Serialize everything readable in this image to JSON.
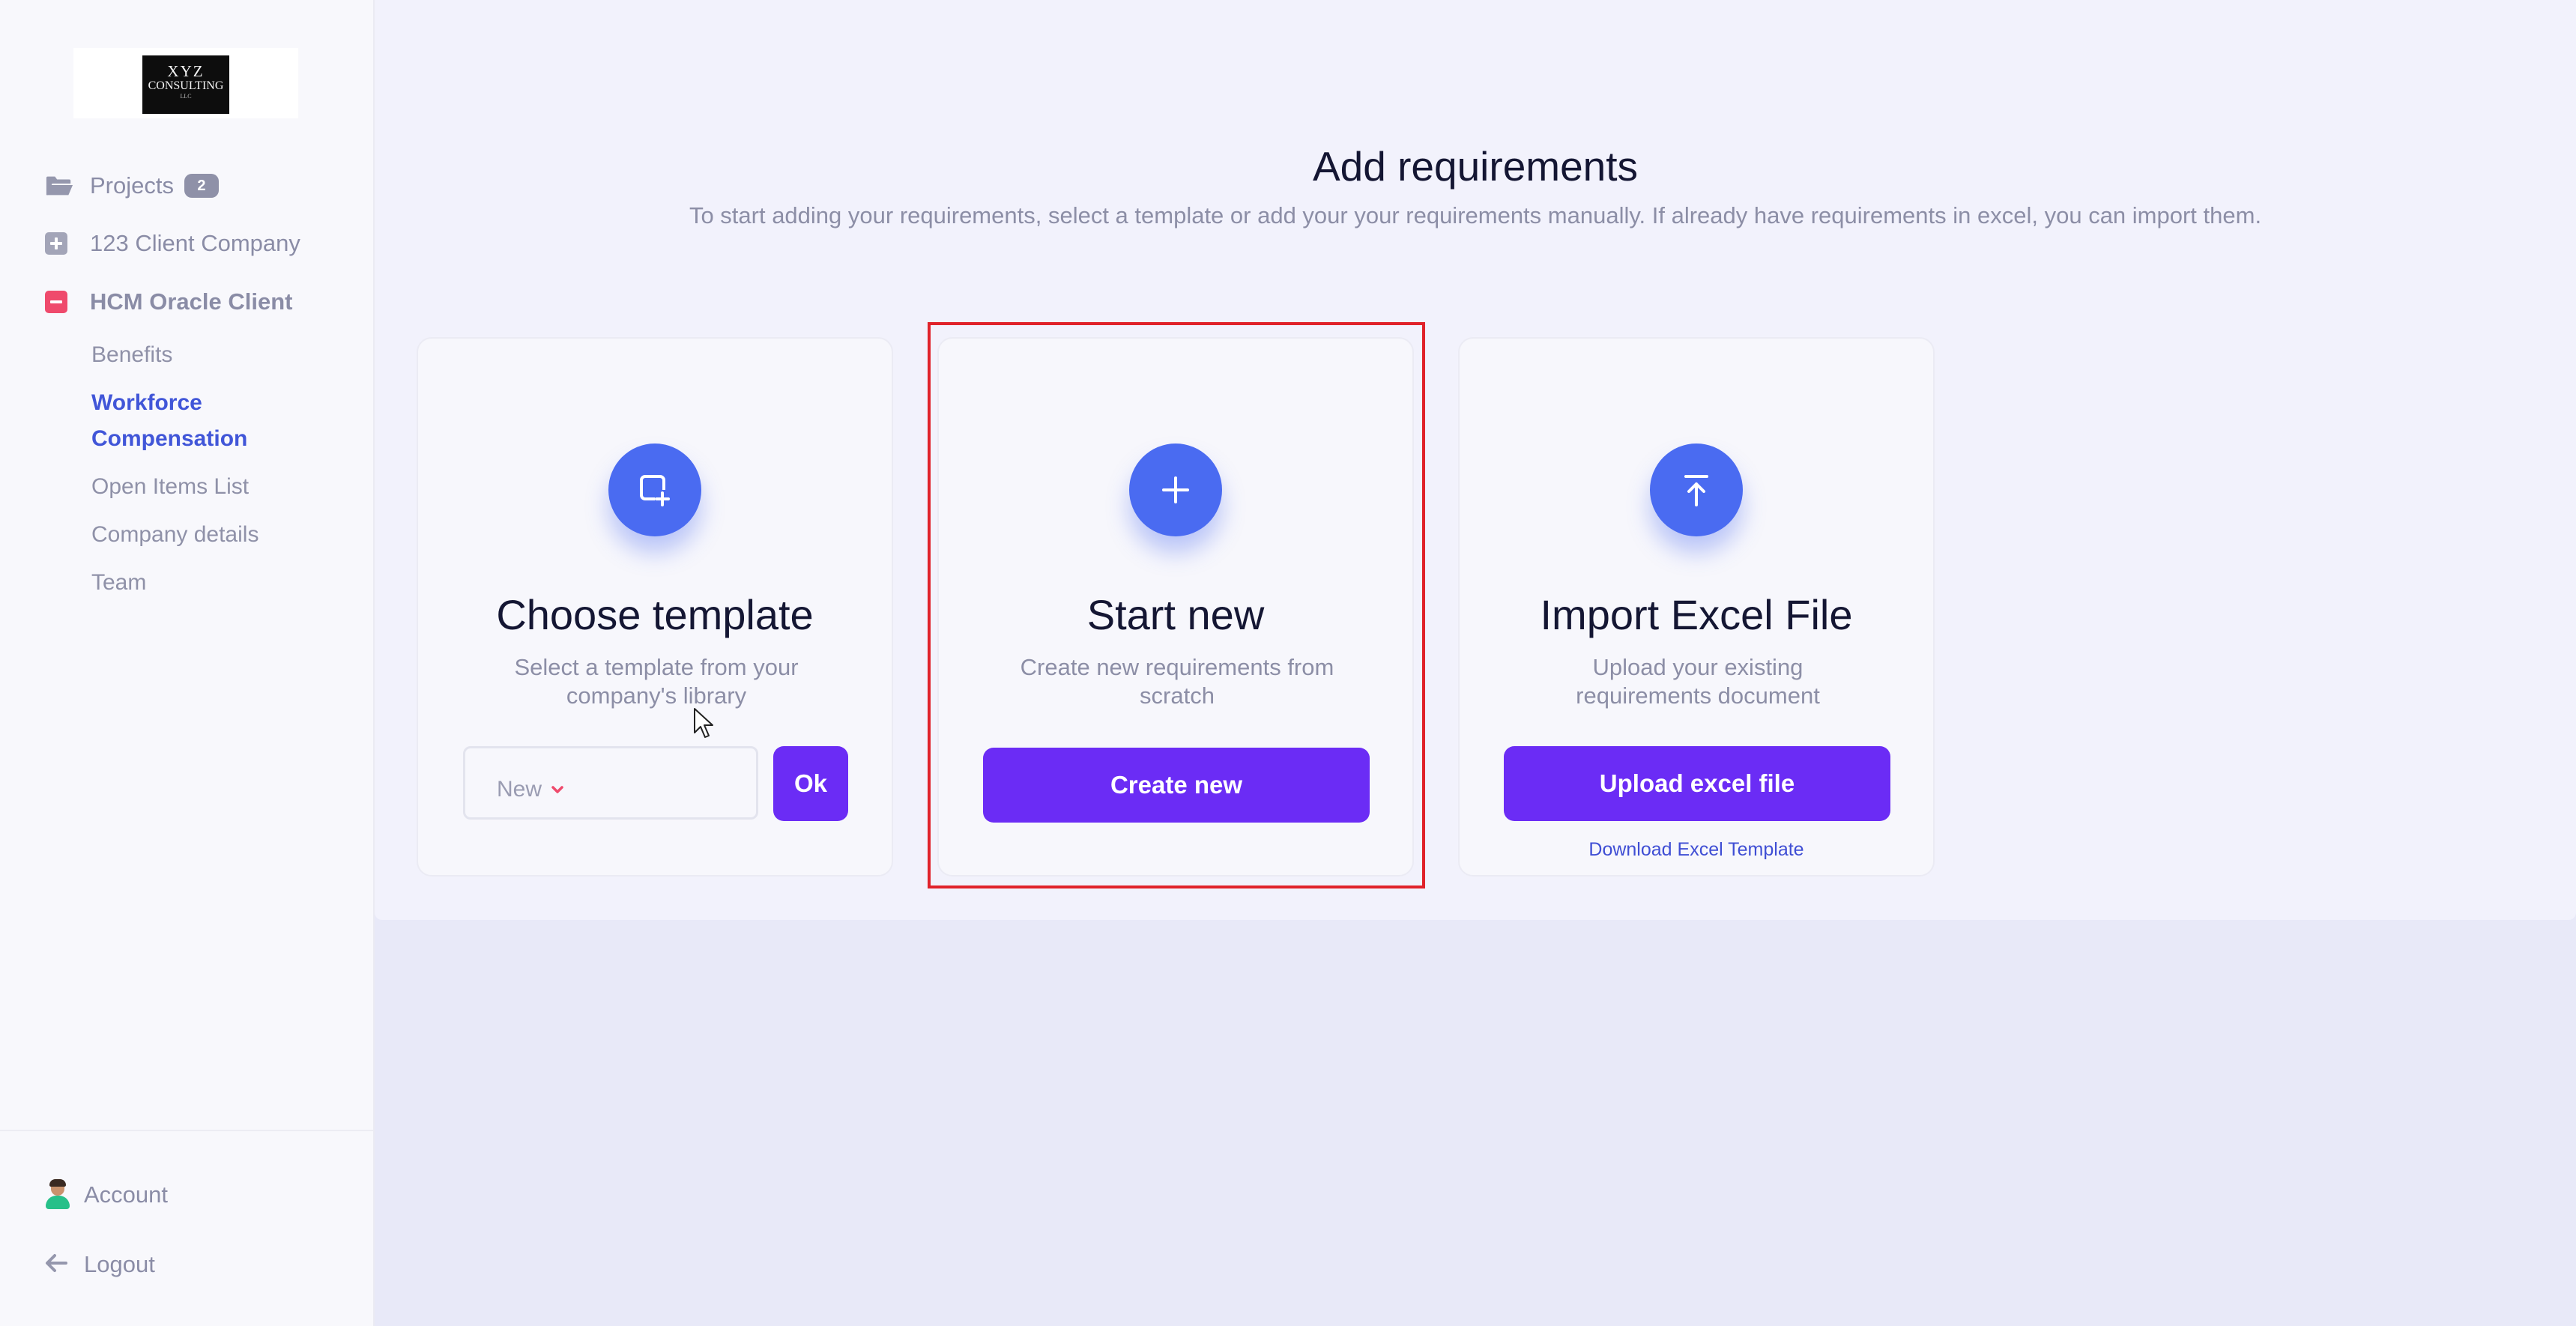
{
  "brand": {
    "logo_text_line1": "XYZ",
    "logo_text_line2": "CONSULTING",
    "logo_text_line3": "LLC"
  },
  "sidebar": {
    "projects": {
      "label": "Projects",
      "count": "2",
      "icon": "folder-open-icon"
    },
    "clients": [
      {
        "label": "123 Client Company",
        "expanded": false,
        "icon": "expand-plus-icon"
      },
      {
        "label": "HCM Oracle Client",
        "expanded": true,
        "icon": "collapse-minus-icon"
      }
    ],
    "sub_items": [
      {
        "label": "Benefits",
        "active": false
      },
      {
        "label": "Workforce Compensation",
        "label_line1": "Workforce",
        "label_line2": "Compensation",
        "active": true
      },
      {
        "label": "Open Items List",
        "active": false
      },
      {
        "label": "Company details",
        "active": false
      },
      {
        "label": "Team",
        "active": false
      }
    ],
    "account_label": "Account",
    "logout_label": "Logout"
  },
  "main": {
    "title": "Add requirements",
    "subtitle": "To start adding your requirements, select a template or add your your requirements manually. If already have requirements in excel, you can import them.",
    "cards": [
      {
        "icon": "add-template-icon",
        "title": "Choose template",
        "description": "Select a template from your company's library",
        "select_value": "New",
        "button_label": "Ok"
      },
      {
        "icon": "plus-icon",
        "title": "Start new",
        "description": "Create new requirements from scratch",
        "button_label": "Create new",
        "highlighted": true
      },
      {
        "icon": "upload-icon",
        "title": "Import Excel File",
        "description": "Upload your existing requirements document",
        "button_label": "Upload excel file",
        "link_label": "Download Excel Template"
      }
    ]
  },
  "colors": {
    "accent_purple": "#6b2cf5",
    "icon_blue": "#4a6bf1",
    "active_nav": "#4156d8",
    "danger": "#ef4a6c",
    "highlight_red": "#e0222a"
  }
}
